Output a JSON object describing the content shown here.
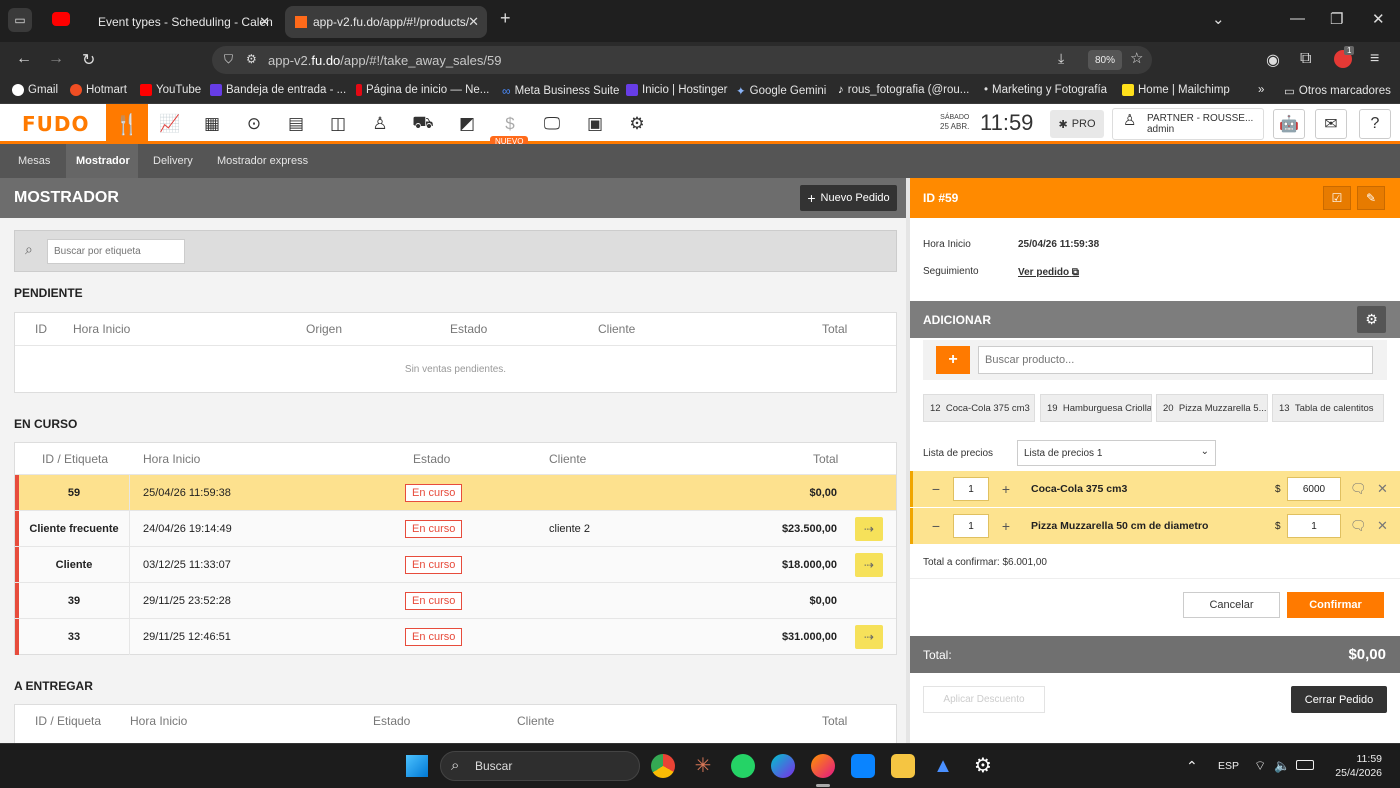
{
  "browser": {
    "tabs": [
      {
        "label": "Event types - Scheduling - Calen"
      },
      {
        "label": "app-v2.fu.do/app/#!/products/"
      }
    ],
    "url_prefix": "app-v2.",
    "url_host": "fu.do",
    "url_path": "/app/#!/take_away_sales/59",
    "zoom": "80%",
    "bookmarks": [
      "Gmail",
      "Hotmart",
      "YouTube",
      "Bandeja de entrada - ...",
      "Página de inicio — Ne...",
      "Meta Business Suite",
      "Inicio | Hostinger",
      "Google Gemini",
      "rous_fotografia (@rou...",
      "Marketing y Fotografía",
      "Home | Mailchimp"
    ],
    "other_bookmarks": "Otros marcadores",
    "ext_badge": "1"
  },
  "app": {
    "logo": "FUDO",
    "nuevo_badge": "NUEVO",
    "day": "SÁBADO",
    "date": "25 ABR.",
    "time": "11:59",
    "pro_label": "PRO",
    "user_name": "PARTNER - ROUSSE...",
    "user_role": "admin"
  },
  "subtabs": [
    "Mesas",
    "Mostrador",
    "Delivery",
    "Mostrador express"
  ],
  "left": {
    "title": "MOSTRADOR",
    "new_order": "Nuevo Pedido",
    "search_placeholder": "Buscar por etiqueta",
    "pending": {
      "title": "PENDIENTE",
      "headers": [
        "ID",
        "Hora Inicio",
        "Origen",
        "Estado",
        "Cliente",
        "Total"
      ],
      "empty": "Sin ventas pendientes."
    },
    "in_progress": {
      "title": "EN CURSO",
      "headers": [
        "ID / Etiqueta",
        "Hora Inicio",
        "Estado",
        "Cliente",
        "Total"
      ],
      "rows": [
        {
          "id": "59",
          "start": "25/04/26 11:59:38",
          "status": "En curso",
          "client": "",
          "total": "$0,00"
        },
        {
          "id": "Cliente frecuente",
          "start": "24/04/26 19:14:49",
          "status": "En curso",
          "client": "cliente 2",
          "total": "$23.500,00"
        },
        {
          "id": "Cliente",
          "start": "03/12/25 11:33:07",
          "status": "En curso",
          "client": "",
          "total": "$18.000,00"
        },
        {
          "id": "39",
          "start": "29/11/25 23:52:28",
          "status": "En curso",
          "client": "",
          "total": "$0,00"
        },
        {
          "id": "33",
          "start": "29/11/25 12:46:51",
          "status": "En curso",
          "client": "",
          "total": "$31.000,00"
        }
      ]
    },
    "to_deliver": {
      "title": "A ENTREGAR",
      "headers": [
        "ID / Etiqueta",
        "Hora Inicio",
        "Estado",
        "Cliente",
        "Total"
      ]
    }
  },
  "right": {
    "title": "ID #59",
    "start_label": "Hora Inicio",
    "start_value": "25/04/26 11:59:38",
    "tracking_label": "Seguimiento",
    "tracking_link": "Ver pedido",
    "add_title": "ADICIONAR",
    "product_placeholder": "Buscar producto...",
    "quick": [
      {
        "count": "12",
        "name": "Coca-Cola 375 cm3"
      },
      {
        "count": "19",
        "name": "Hamburguesa Criolla"
      },
      {
        "count": "20",
        "name": "Pizza Muzzarella 5..."
      },
      {
        "count": "13",
        "name": "Tabla de calentitos"
      }
    ],
    "price_list_label": "Lista de precios",
    "price_list_value": "Lista de precios 1",
    "items": [
      {
        "qty": "1",
        "name": "Coca-Cola 375 cm3",
        "currency": "$",
        "price": "6000"
      },
      {
        "qty": "1",
        "name": "Pizza Muzzarella 50 cm de diametro",
        "currency": "$",
        "price": "1"
      }
    ],
    "to_confirm": "Total a confirmar: $6.001,00",
    "cancel": "Cancelar",
    "confirm": "Confirmar",
    "total_label": "Total:",
    "total_value": "$0,00",
    "discount": "Aplicar Descuento",
    "close_order": "Cerrar Pedido"
  },
  "taskbar": {
    "search": "Buscar",
    "lang": "ESP",
    "time": "11:59",
    "date": "25/4/2026"
  }
}
